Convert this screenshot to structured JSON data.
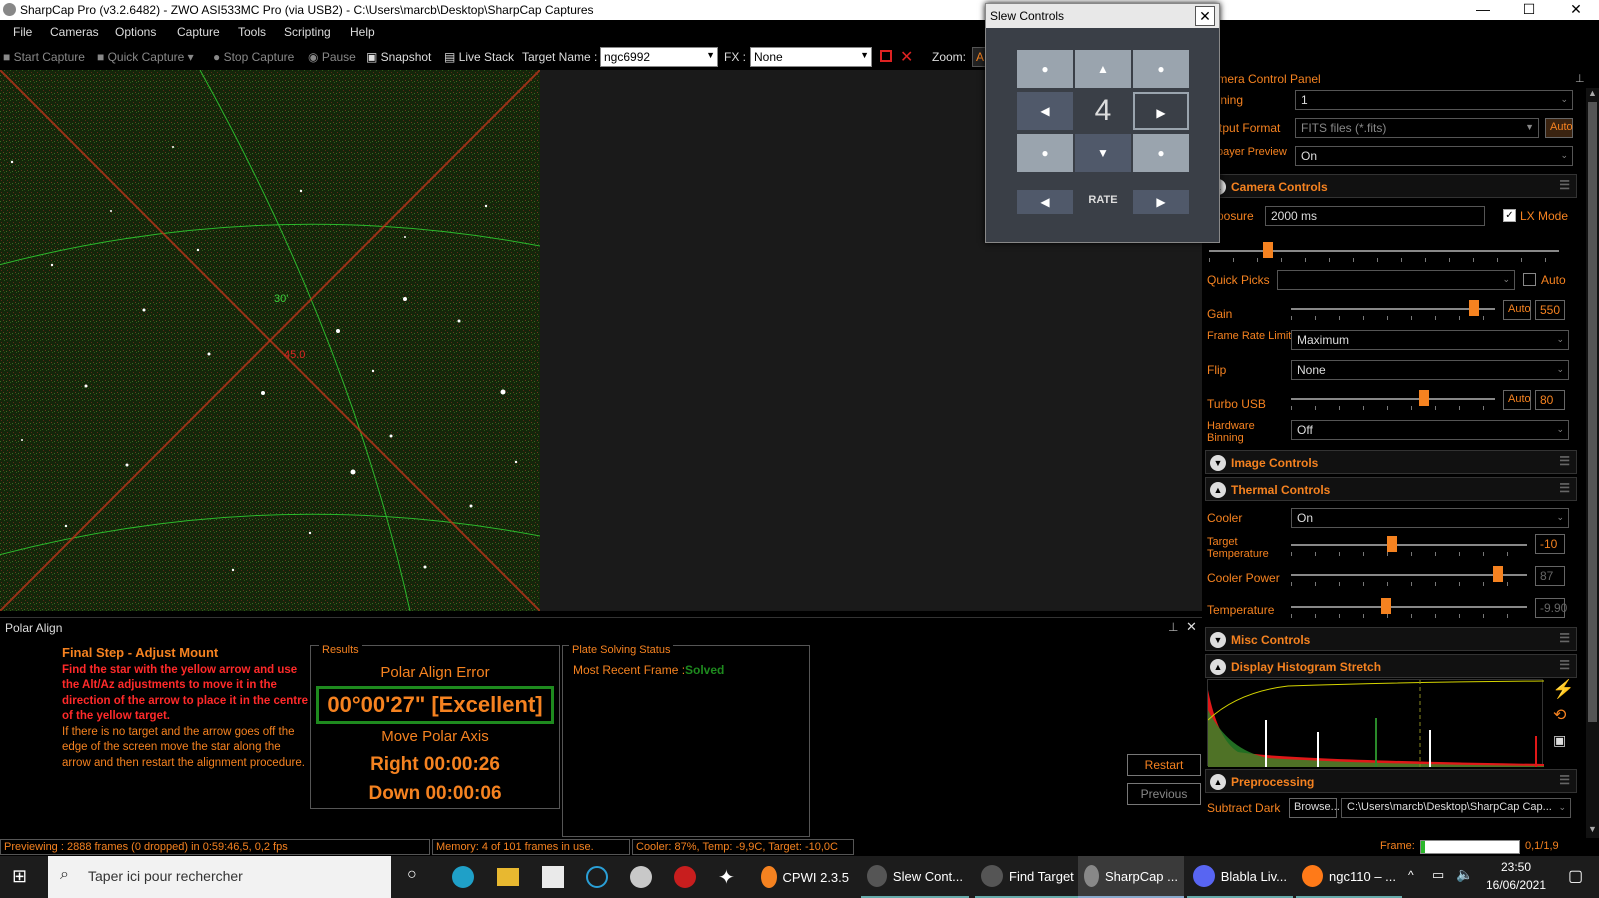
{
  "window": {
    "title": "SharpCap Pro (v3.2.6482) - ZWO ASI533MC Pro (via USB2) - C:\\Users\\marcb\\Desktop\\SharpCap Captures",
    "minimize": "—",
    "maximize": "☐",
    "close": "✕"
  },
  "menu": [
    "File",
    "Cameras",
    "Options",
    "Capture",
    "Tools",
    "Scripting",
    "Help"
  ],
  "toolbar": {
    "start_capture": "Start Capture",
    "quick_capture": "Quick Capture",
    "stop_capture": "Stop Capture",
    "pause": "Pause",
    "snapshot": "Snapshot",
    "live_stack": "Live Stack",
    "target_name_label": "Target Name :",
    "target_name_value": "ngc6992",
    "fx_label": "FX :",
    "fx_value": "None",
    "zoom_label": "Zoom:",
    "zoom_value": "A"
  },
  "viewer": {
    "label_30": "30'",
    "label_45": "45.0"
  },
  "slew": {
    "title": "Slew Controls",
    "close": "✕",
    "rate_number": "4",
    "rate_label": "RATE",
    "up": "▲",
    "down": "▼",
    "left": "◀",
    "right": "▶",
    "dot": "●"
  },
  "panel": {
    "title": "Camera Control Panel",
    "pin": "⊥",
    "binning_label": "Binning",
    "binning_value": "1",
    "output_label": "Output Format",
    "output_value": "FITS files (*.fits)",
    "output_auto": "Auto",
    "debayer_label": "Debayer Preview",
    "debayer_value": "On",
    "camera_controls": "Camera Controls",
    "exposure_label": "Exposure",
    "exposure_value": "2000 ms",
    "lx_mode": "LX Mode",
    "quick_picks": "Quick Picks",
    "auto": "Auto",
    "gain_label": "Gain",
    "gain_value": "550",
    "gain_level": 0.92,
    "frame_rate_label": "Frame Rate Limit",
    "frame_rate_value": "Maximum",
    "flip_label": "Flip",
    "flip_value": "None",
    "turbo_label": "Turbo USB",
    "turbo_value": "80",
    "turbo_level": 0.66,
    "hw_binning_label": "Hardware Binning",
    "hw_binning_value": "Off",
    "image_controls": "Image Controls",
    "thermal_controls": "Thermal Controls",
    "cooler_label": "Cooler",
    "cooler_value": "On",
    "target_temp_label": "Target Temperature",
    "target_temp_value": "-10",
    "cooler_power_label": "Cooler Power",
    "cooler_power_value": "87",
    "temperature_label": "Temperature",
    "temperature_value": "-9.90",
    "misc_controls": "Misc Controls",
    "histogram": "Display Histogram Stretch",
    "preprocessing": "Preprocessing",
    "subtract_dark_label": "Subtract Dark",
    "browse": "Browse...",
    "dark_path": "C:\\Users\\marcb\\Desktop\\SharpCap Cap..."
  },
  "polar": {
    "header": "Polar Align",
    "step_title": "Final Step - Adjust Mount",
    "instruction_red": "Find the star with the yellow arrow and use the Alt/Az adjustments to move it in the direction of the arrow to place it in the centre of the yellow target.",
    "instruction_white": "If there is no target and the arrow goes off the edge of the screen move the star along the arrow and then restart the alignment procedure.",
    "results_label": "Results",
    "error_label": "Polar Align Error",
    "error_value": "00°00'27\" [Excellent]",
    "move_label": "Move Polar Axis",
    "right_value": "Right 00:00:26",
    "down_value": "Down 00:00:06",
    "plate_label": "Plate Solving Status",
    "recent_label": "Most Recent Frame :",
    "recent_value": "Solved",
    "restart": "Restart",
    "previous": "Previous"
  },
  "status": {
    "previewing": "Previewing : 2888 frames (0 dropped) in 0:59:46,5, 0,2 fps",
    "memory": "Memory: 4 of 101 frames in use.",
    "cooler": "Cooler: 87%, Temp: -9,9C, Target: -10,0C",
    "frame_label": "Frame:",
    "frame_value": "0,1/1,9"
  },
  "taskbar": {
    "search": "Taper ici pour rechercher",
    "apps": [
      "CPWI 2.3.5",
      "Slew Cont...",
      "Find Target",
      "SharpCap ...",
      "Blabla Liv...",
      "ngc110 – ..."
    ],
    "time": "23:50",
    "date": "16/06/2021"
  }
}
